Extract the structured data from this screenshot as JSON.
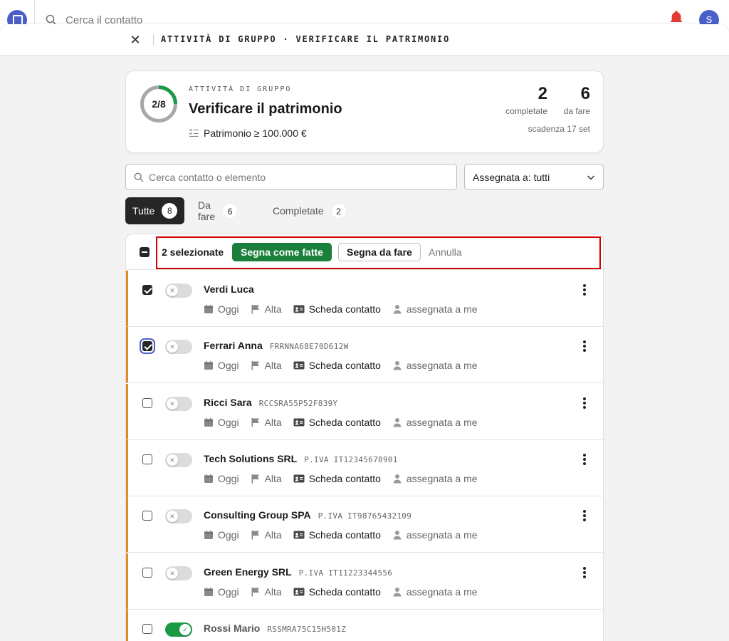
{
  "app": {
    "search_placeholder": "Cerca il contatto",
    "avatar_initial": "S"
  },
  "sheet": {
    "title": "ATTIVITÀ DI GRUPPO · VERIFICARE IL PATRIMONIO"
  },
  "summary": {
    "progress_label": "2/8",
    "progress_fraction": 0.25,
    "kicker": "ATTIVITÀ DI GRUPPO",
    "title": "Verificare il patrimonio",
    "criterion": "Patrimonio ≥ 100.000 €",
    "completed_count": "2",
    "completed_label": "completate",
    "todo_count": "6",
    "todo_label": "da fare",
    "due": "scadenza 17 set"
  },
  "filters": {
    "search_placeholder": "Cerca contatto o elemento",
    "assigned_label": "Assegnata a: tutti"
  },
  "tabs": [
    {
      "label": "Tutte",
      "count": "8"
    },
    {
      "label": "Da fare",
      "count": "6"
    },
    {
      "label": "Completate",
      "count": "2"
    }
  ],
  "bulk": {
    "selected": "2 selezionate",
    "mark_done": "Segna come fatte",
    "mark_todo": "Segna da fare",
    "cancel": "Annulla"
  },
  "rows": [
    {
      "name": "Verdi Luca",
      "code": "",
      "date": "Oggi",
      "priority": "Alta",
      "contact": "Scheda contatto",
      "assignee": "assegnata a me",
      "checked": true,
      "done": false
    },
    {
      "name": "Ferrari Anna",
      "code": "FRRNNA68E70D612W",
      "date": "Oggi",
      "priority": "Alta",
      "contact": "Scheda contatto",
      "assignee": "assegnata a me",
      "checked": true,
      "done": false
    },
    {
      "name": "Ricci Sara",
      "code": "RCCSRA55P52F839Y",
      "date": "Oggi",
      "priority": "Alta",
      "contact": "Scheda contatto",
      "assignee": "assegnata a me",
      "checked": false,
      "done": false
    },
    {
      "name": "Tech Solutions SRL",
      "code": "P.IVA IT12345678901",
      "date": "Oggi",
      "priority": "Alta",
      "contact": "Scheda contatto",
      "assignee": "assegnata a me",
      "checked": false,
      "done": false
    },
    {
      "name": "Consulting Group SPA",
      "code": "P.IVA IT98765432109",
      "date": "Oggi",
      "priority": "Alta",
      "contact": "Scheda contatto",
      "assignee": "assegnata a me",
      "checked": false,
      "done": false
    },
    {
      "name": "Green Energy SRL",
      "code": "P.IVA IT11223344556",
      "date": "Oggi",
      "priority": "Alta",
      "contact": "Scheda contatto",
      "assignee": "assegnata a me",
      "checked": false,
      "done": false
    },
    {
      "name": "Rossi Mario",
      "code": "RSSMRA75C15H501Z",
      "date": "",
      "priority": "",
      "contact": "",
      "assignee": "",
      "checked": false,
      "done": true
    }
  ],
  "colors": {
    "accent": "#1a7f3a",
    "row_marker": "#e08a2a",
    "highlight": "#d60000",
    "brand": "#4b5fc9"
  }
}
